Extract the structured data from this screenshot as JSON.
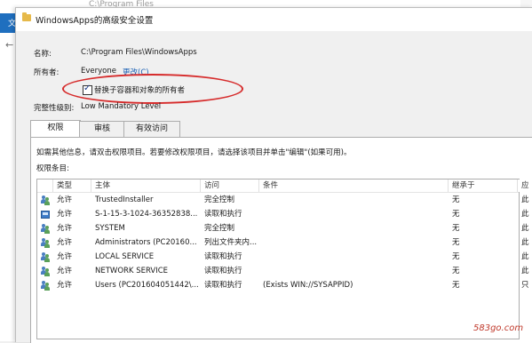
{
  "background": {
    "window_title": "C:\\Program Files",
    "ribbon_tab": "文"
  },
  "dialog": {
    "title": "WindowsApps的高级安全设置",
    "name_label": "名称:",
    "name_value": "C:\\Program Files\\WindowsApps",
    "owner_label": "所有者:",
    "owner_value": "Everyone",
    "change_link": "更改(C)",
    "replace_owner_checkbox": "替换子容器和对象的所有者",
    "integrity_label": "完整性级别:",
    "integrity_value": "Low Mandatory Level",
    "tabs": [
      "权限",
      "审核",
      "有效访问"
    ],
    "info_text": "如需其他信息，请双击权限项目。若要修改权限项目，请选择该项目并单击\"编辑\"(如果可用)。",
    "entries_label": "权限条目:"
  },
  "table": {
    "columns": [
      "类型",
      "主体",
      "访问",
      "条件",
      "继承于",
      "应"
    ],
    "rows": [
      {
        "icon": "user-group-icon",
        "type": "允许",
        "principal": "TrustedInstaller",
        "access": "完全控制",
        "condition": "",
        "inherited": "无",
        "applies": "此"
      },
      {
        "icon": "sid-icon",
        "type": "允许",
        "principal": "S-1-15-3-1024-36352838...",
        "access": "读取和执行",
        "condition": "",
        "inherited": "无",
        "applies": "此"
      },
      {
        "icon": "user-group-icon",
        "type": "允许",
        "principal": "SYSTEM",
        "access": "完全控制",
        "condition": "",
        "inherited": "无",
        "applies": "此"
      },
      {
        "icon": "user-group-icon",
        "type": "允许",
        "principal": "Administrators (PC20160...",
        "access": "列出文件夹内...",
        "condition": "",
        "inherited": "无",
        "applies": "此"
      },
      {
        "icon": "user-group-icon",
        "type": "允许",
        "principal": "LOCAL SERVICE",
        "access": "读取和执行",
        "condition": "",
        "inherited": "无",
        "applies": "此"
      },
      {
        "icon": "user-group-icon",
        "type": "允许",
        "principal": "NETWORK SERVICE",
        "access": "读取和执行",
        "condition": "",
        "inherited": "无",
        "applies": "此"
      },
      {
        "icon": "user-group-icon",
        "type": "允许",
        "principal": "Users (PC201604051442\\...",
        "access": "读取和执行",
        "condition": "(Exists WIN://SYSAPPID)",
        "inherited": "无",
        "applies": "只"
      }
    ]
  },
  "watermark": "583go.com",
  "colors": {
    "annotation": "#d62b2b",
    "link": "#1a5fb4"
  }
}
